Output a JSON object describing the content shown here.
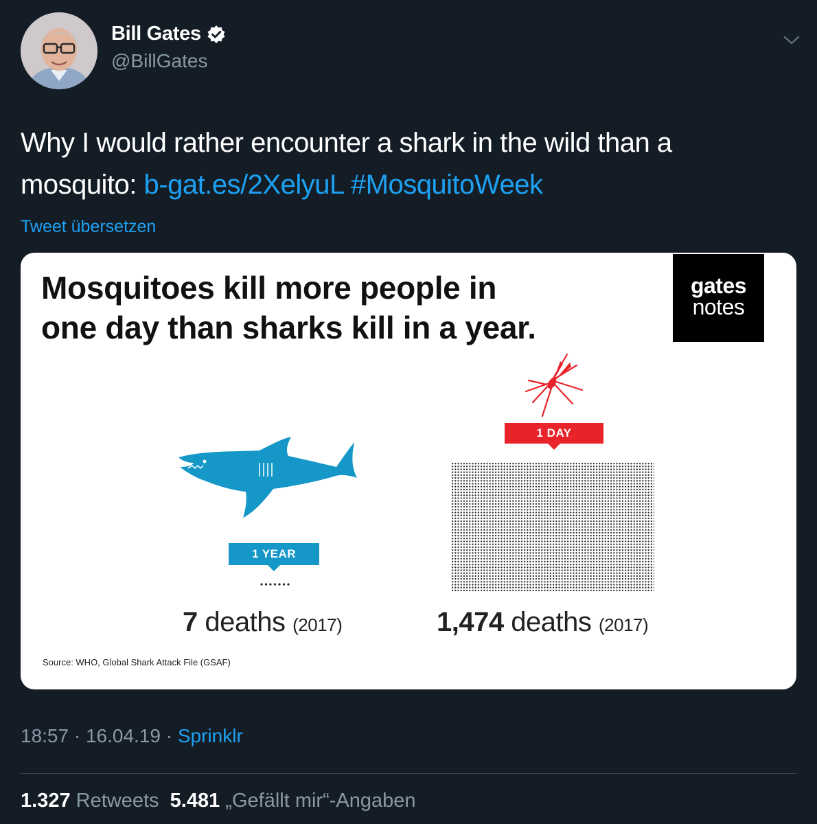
{
  "user": {
    "display_name": "Bill Gates",
    "handle": "@BillGates",
    "avatar_icon": "profile-photo",
    "verified_icon": "verified-badge-icon"
  },
  "tweet": {
    "text": "Why I would rather encounter a shark in the wild than a mosquito: ",
    "link": "b-gat.es/2XelyuL",
    "hashtag": "#MosquitoWeek",
    "translate_label": "Tweet übersetzen"
  },
  "card": {
    "headline_line1": "Mosquitoes kill more people in",
    "headline_line2": "one day than sharks kill in a year.",
    "logo_line1": "gates",
    "logo_line2": "notes",
    "shark_icon": "shark-icon",
    "mosquito_icon": "mosquito-icon",
    "shark_tag": "1 YEAR",
    "mosquito_tag": "1 DAY",
    "shark_deaths_num": "7",
    "mosquito_deaths_num": "1,474",
    "deaths_word": "deaths",
    "year_label": "(2017)",
    "source": "Source: WHO, Global Shark Attack File (GSAF)",
    "shark_color": "#1597c7",
    "mosquito_color": "#e8232a"
  },
  "meta": {
    "time": "18:57",
    "date": "16.04.19",
    "client": "Sprinklr",
    "separator": "·"
  },
  "stats": {
    "retweets_count": "1.327",
    "retweets_label": "Retweets",
    "likes_count": "5.481",
    "likes_label": "„Gefällt mir“-Angaben"
  },
  "colors": {
    "background": "#141d26",
    "accent": "#1da1f2",
    "secondary_text": "#8899a6"
  }
}
